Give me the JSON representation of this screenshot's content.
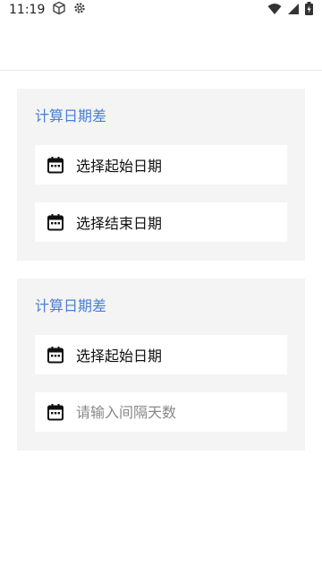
{
  "status_bar": {
    "time": "11:19"
  },
  "cards": [
    {
      "title": "计算日期差",
      "rows": [
        {
          "label": "选择起始日期"
        },
        {
          "label": "选择结束日期"
        }
      ]
    },
    {
      "title": "计算日期差",
      "rows": [
        {
          "label": "选择起始日期"
        }
      ],
      "input": {
        "value": "",
        "placeholder": "请输入间隔天数"
      }
    }
  ],
  "colors": {
    "accent": "#4a7fd6",
    "card_bg": "#f4f4f4"
  },
  "icons": {
    "calendar": "calendar-icon",
    "box": "box-icon",
    "settings": "gear-icon",
    "wifi": "wifi-icon",
    "signal": "signal-icon",
    "battery": "battery-icon"
  }
}
